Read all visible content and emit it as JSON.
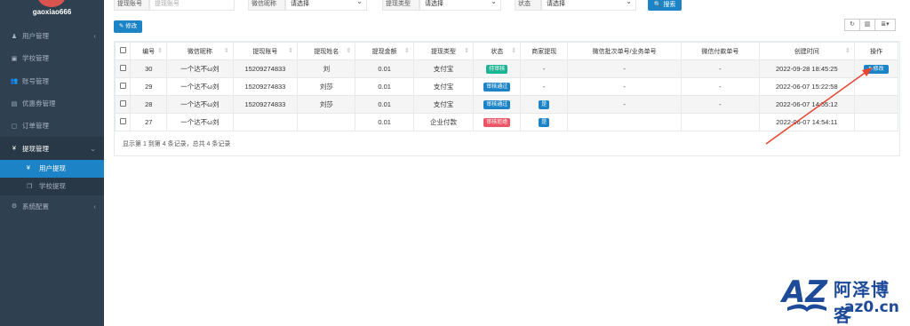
{
  "sidebar": {
    "username": "gaoxiao666",
    "menu": [
      {
        "label": "用户管理",
        "icon": "user-icon",
        "glyph": "♟",
        "arrow": "‹"
      },
      {
        "label": "学校管理",
        "icon": "school-icon",
        "glyph": "▣",
        "arrow": ""
      },
      {
        "label": "账号管理",
        "icon": "users-icon",
        "glyph": "👥",
        "arrow": ""
      },
      {
        "label": "优惠券管理",
        "icon": "coupon-icon",
        "glyph": "▤",
        "arrow": ""
      },
      {
        "label": "订单管理",
        "icon": "order-icon",
        "glyph": "▢",
        "arrow": ""
      },
      {
        "label": "提现管理",
        "icon": "yen-icon",
        "glyph": "¥",
        "arrow": "⌄"
      }
    ],
    "submenu": [
      {
        "label": "用户提现",
        "glyph": "¥",
        "icon": "yen-icon"
      },
      {
        "label": "学校提现",
        "glyph": "❐",
        "icon": "copy-icon"
      }
    ],
    "system": {
      "label": "系统配置",
      "glyph": "⚙",
      "icon": "gear-icon",
      "arrow": "‹"
    }
  },
  "filters": {
    "account_label": "提现账号",
    "account_placeholder": "提现账号",
    "wechat_label": "微信昵称",
    "wechat_value": "请选择",
    "type_label": "提现类型",
    "type_value": "请选择",
    "status_label": "状态",
    "status_value": "请选择",
    "search_label": "搜索"
  },
  "toolbar": {
    "edit_label": "修改",
    "refresh_glyph": "↻",
    "columns_glyph": "▥",
    "export_glyph": "≣▾"
  },
  "table": {
    "headers": [
      "编号",
      "微信昵称",
      "提现账号",
      "提现姓名",
      "提现金额",
      "提现类型",
      "状态",
      "商家提现",
      "微信批次单号/业务单号",
      "微信付款单号",
      "创建时间",
      "操作"
    ],
    "rows": [
      {
        "id": "30",
        "nick": "一个达不ω刘",
        "account": "15209274833",
        "name": "刘",
        "amount": "0.01",
        "type": "支付宝",
        "status": "待审核",
        "status_color": "green",
        "merchant": "-",
        "batch": "-",
        "pay": "-",
        "time": "2022-09-28 18:45:25",
        "action": "修改"
      },
      {
        "id": "29",
        "nick": "一个达不ω刘",
        "account": "15209274833",
        "name": "刘莎",
        "amount": "0.01",
        "type": "支付宝",
        "status": "审核通过",
        "status_color": "blue",
        "merchant": "-",
        "batch": "-",
        "pay": "-",
        "time": "2022-06-07 15:22:58",
        "action": ""
      },
      {
        "id": "28",
        "nick": "一个达不ω刘",
        "account": "15209274833",
        "name": "刘莎",
        "amount": "0.01",
        "type": "支付宝",
        "status": "审核通过",
        "status_color": "blue",
        "merchant": "是",
        "batch": "-",
        "pay": "-",
        "time": "2022-06-07 14:55:12",
        "action": ""
      },
      {
        "id": "27",
        "nick": "一个达不ω刘",
        "account": "",
        "name": "",
        "amount": "0.01",
        "type": "企业付款",
        "status": "审核拒绝",
        "status_color": "red",
        "merchant": "是",
        "batch": "-",
        "pay": "-",
        "time": "2022-06-07 14:54:11",
        "action": ""
      }
    ],
    "footer": "显示第 1 到第 4 条记录，总共 4 条记录"
  },
  "watermark": {
    "logo": "AZ",
    "name": "阿泽博客",
    "domain": "az0.cn"
  },
  "colors": {
    "sidebar_bg": "#2f4050",
    "accent": "#1c84c6",
    "arrow": "#e8442f"
  }
}
